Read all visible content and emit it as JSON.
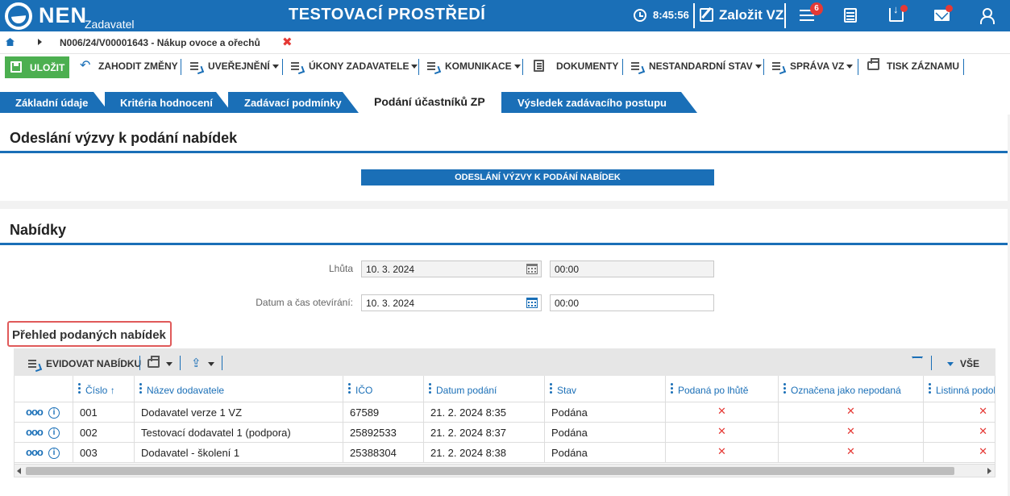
{
  "header": {
    "brand": "NEN",
    "brand_sub": "Zadavatel",
    "environment": "TESTOVACÍ PROSTŘEDÍ",
    "time": "8:45:56",
    "create_label": "Založit VZ",
    "notification_count": "6"
  },
  "breadcrumb": {
    "text": "N006/24/V00001643 - Nákup ovoce a ořechů",
    "close_glyph": "✖"
  },
  "toolbar": {
    "save": "ULOŽIT",
    "discard": "ZAHODIT ZMĚNY",
    "publish": "UVEŘEJNĚNÍ",
    "actions": "ÚKONY ZADAVATELE",
    "communication": "KOMUNIKACE",
    "documents": "DOKUMENTY",
    "nonstandard": "NESTANDARDNÍ STAV",
    "management": "SPRÁVA VZ",
    "print": "TISK ZÁZNAMU"
  },
  "tabs": [
    {
      "label": "Základní údaje"
    },
    {
      "label": "Kritéria hodnocení"
    },
    {
      "label": "Zadávací podmínky"
    },
    {
      "label": "Podání účastníků ZP"
    },
    {
      "label": "Výsledek zadávacího postupu"
    }
  ],
  "invitation": {
    "title": "Odeslání výzvy k podání nabídek",
    "button": "ODESLÁNÍ VÝZVY K PODÁNÍ NABÍDEK"
  },
  "offers": {
    "title": "Nabídky",
    "deadline_label": "Lhůta",
    "deadline_date": "10. 3. 2024",
    "deadline_time": "00:00",
    "opening_label": "Datum a čas otevírání:",
    "opening_date": "10. 3. 2024",
    "opening_time": "00:00",
    "overview_title": "Přehled podaných nabídek"
  },
  "grid": {
    "register_button": "EVIDOVAT NABÍDKU",
    "all_label": "VŠE",
    "columns": [
      "Číslo",
      "Název dodavatele",
      "IČO",
      "Datum podání",
      "Stav",
      "Podaná po lhůtě",
      "Označena jako nepodaná",
      "Listinná podoba"
    ],
    "sort_glyph": "↑",
    "more_glyph": "ooo",
    "info_glyph": "i",
    "x_glyph": "✕",
    "rows": [
      {
        "cislo": "001",
        "nazev": "Dodavatel verze 1 VZ",
        "ico": "67589",
        "datum": "21. 2. 2024 8:35",
        "stav": "Podána"
      },
      {
        "cislo": "002",
        "nazev": "Testovací dodavatel 1 (podpora)",
        "ico": "25892533",
        "datum": "21. 2. 2024 8:37",
        "stav": "Podána"
      },
      {
        "cislo": "003",
        "nazev": "Dodavatel - školení 1",
        "ico": "25388304",
        "datum": "21. 2. 2024 8:38",
        "stav": "Podána"
      }
    ]
  },
  "colors": {
    "primary": "#1a6fb7",
    "save_green": "#4caf50",
    "alert_red": "#e53935",
    "highlight_border": "#e05a5a"
  }
}
